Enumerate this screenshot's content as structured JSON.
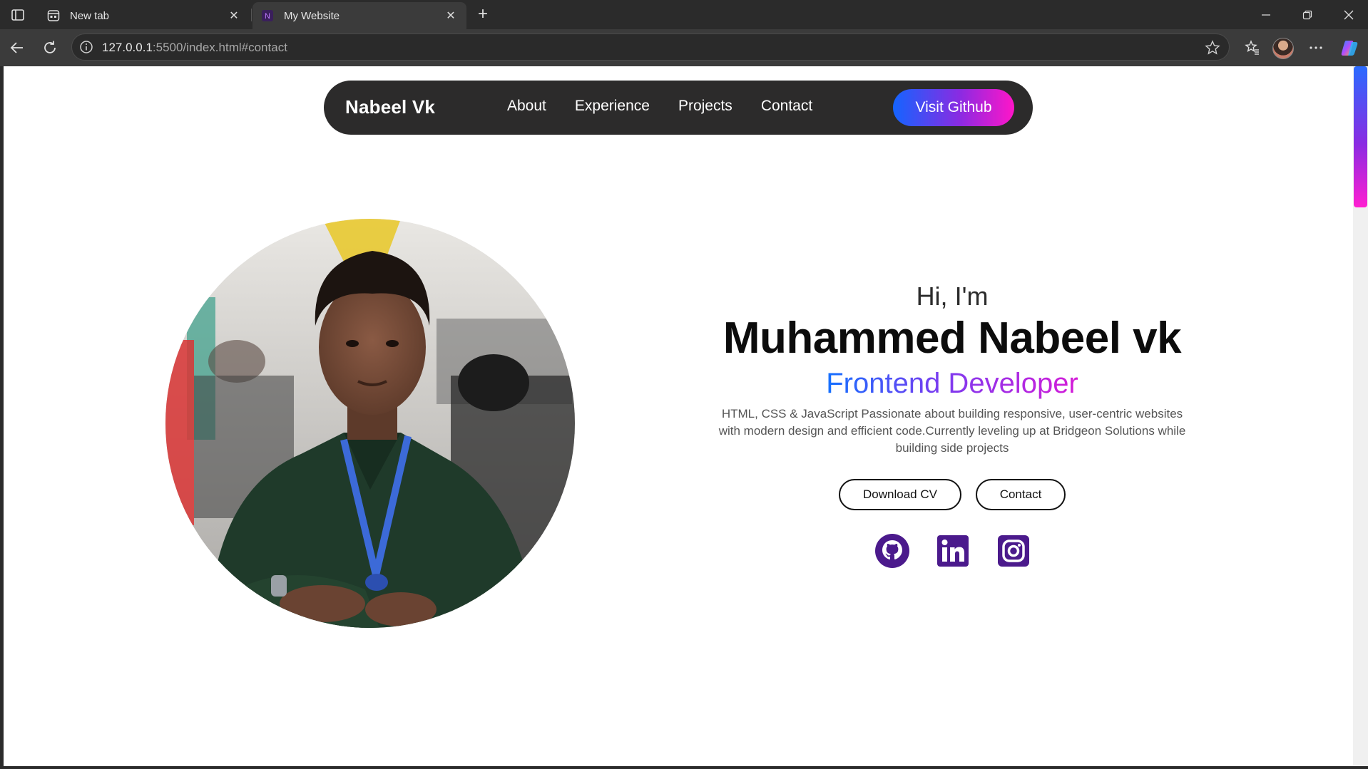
{
  "browser": {
    "tabs": [
      {
        "title": "New tab",
        "active": false
      },
      {
        "title": "My Website",
        "active": true
      }
    ],
    "url_host": "127.0.0.1",
    "url_rest": ":5500/index.html#contact"
  },
  "nav": {
    "brand": "Nabeel Vk",
    "links": [
      "About",
      "Experience",
      "Projects",
      "Contact"
    ],
    "cta": "Visit Github"
  },
  "hero": {
    "greeting": "Hi, I'm",
    "name": "Muhammed Nabeel vk",
    "role": "Frontend Developer",
    "bio": "HTML, CSS & JavaScript Passionate about building responsive, user-centric websites with modern design and efficient code.Currently leveling up at Bridgeon Solutions while building side projects",
    "buttons": {
      "cv": "Download CV",
      "contact": "Contact"
    },
    "socials": [
      "github-icon",
      "linkedin-icon",
      "instagram-icon"
    ]
  },
  "colors": {
    "accent_start": "#1464ff",
    "accent_mid": "#8a2be2",
    "accent_end": "#ff15c8",
    "social_icon": "#4b1a8c",
    "nav_bg": "#2c2b2b"
  }
}
